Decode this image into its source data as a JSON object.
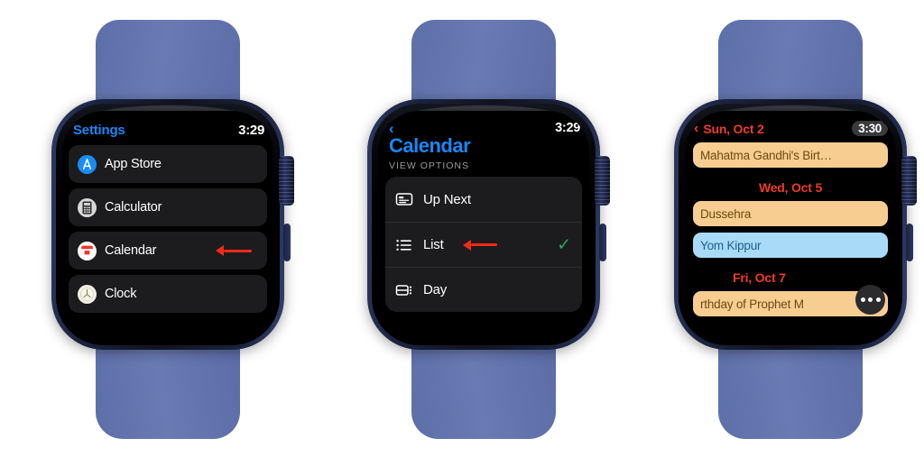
{
  "watches": [
    {
      "id": "watch-settings",
      "screen": "settings",
      "header": {
        "title": "Settings",
        "time": "3:29"
      },
      "rows": [
        {
          "label": "App Store",
          "icon": "app-store-icon",
          "arrow": false
        },
        {
          "label": "Calculator",
          "icon": "calculator-icon",
          "arrow": false
        },
        {
          "label": "Calendar",
          "icon": "calendar-icon",
          "arrow": true
        },
        {
          "label": "Clock",
          "icon": "clock-icon",
          "arrow": false
        }
      ]
    },
    {
      "id": "watch-calendar-settings",
      "screen": "calendar-view-options",
      "header": {
        "back": "‹",
        "title": "Calendar",
        "time": "3:29",
        "section": "VIEW OPTIONS"
      },
      "options": [
        {
          "label": "Up Next",
          "icon": "up-next-icon",
          "checked": false,
          "arrow": false
        },
        {
          "label": "List",
          "icon": "list-icon",
          "checked": true,
          "arrow": true
        },
        {
          "label": "Day",
          "icon": "day-icon",
          "checked": false,
          "arrow": false
        }
      ],
      "checkmark": "✓"
    },
    {
      "id": "watch-calendar-list",
      "screen": "calendar-list",
      "header": {
        "back": "‹",
        "date": "Sun, Oct 2",
        "time": "3:30"
      },
      "groups": [
        {
          "date": null,
          "events": [
            {
              "title": "Mahatma Gandhi's Birt…",
              "color": "orange"
            }
          ]
        },
        {
          "date": "Wed, Oct 5",
          "events": [
            {
              "title": "Dussehra",
              "color": "orange"
            },
            {
              "title": "Yom Kippur",
              "color": "blue"
            }
          ]
        },
        {
          "date": "Fri, Oct 7",
          "events": [
            {
              "title": "rthday of Prophet M",
              "color": "orange"
            }
          ]
        }
      ],
      "more_button": "more-options-button"
    }
  ],
  "colors": {
    "band": "#6274aa",
    "case": "#1b2440",
    "accent_blue": "#1b86f4",
    "accent_red": "#f03b26",
    "pointer_red": "#f02b17",
    "check_green": "#2aa949",
    "event_orange": "#f8cd91",
    "event_blue": "#a9dbf8",
    "row_bg": "#1c1c1e"
  }
}
